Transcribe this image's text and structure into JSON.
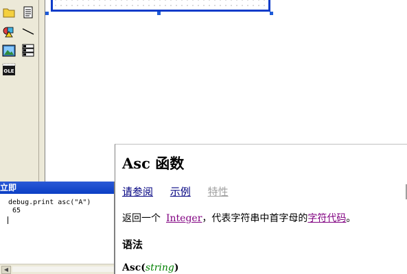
{
  "toolbox": {
    "tools": [
      {
        "icon": "folder-icon"
      },
      {
        "icon": "document-icon"
      },
      {
        "icon": "shapes-icon"
      },
      {
        "icon": "line-icon"
      },
      {
        "icon": "image-icon"
      },
      {
        "icon": "multipage-icon"
      },
      {
        "icon": "ole-icon",
        "label": "OLE"
      }
    ]
  },
  "immediate": {
    "title": "立即",
    "lines": [
      "debug.print asc(\"A\")",
      " 65"
    ]
  },
  "help": {
    "title": "Asc 函数",
    "links": {
      "see_also": "请参阅",
      "example": "示例",
      "properties": "特性"
    },
    "desc": {
      "prefix": "返回一个",
      "link_integer": "Integer",
      "middle": "，代表字符串中首字母的",
      "link_charcode": "字符代码",
      "suffix": "。"
    },
    "section_syntax": "语法",
    "syntax": {
      "func": "Asc(",
      "param": "string",
      "close": ")"
    }
  },
  "colors": {
    "title_bar": "#0b3fc5",
    "link": "#000080",
    "visited_link": "#800080",
    "disabled_link": "#a0a0a0",
    "param": "#008000"
  }
}
